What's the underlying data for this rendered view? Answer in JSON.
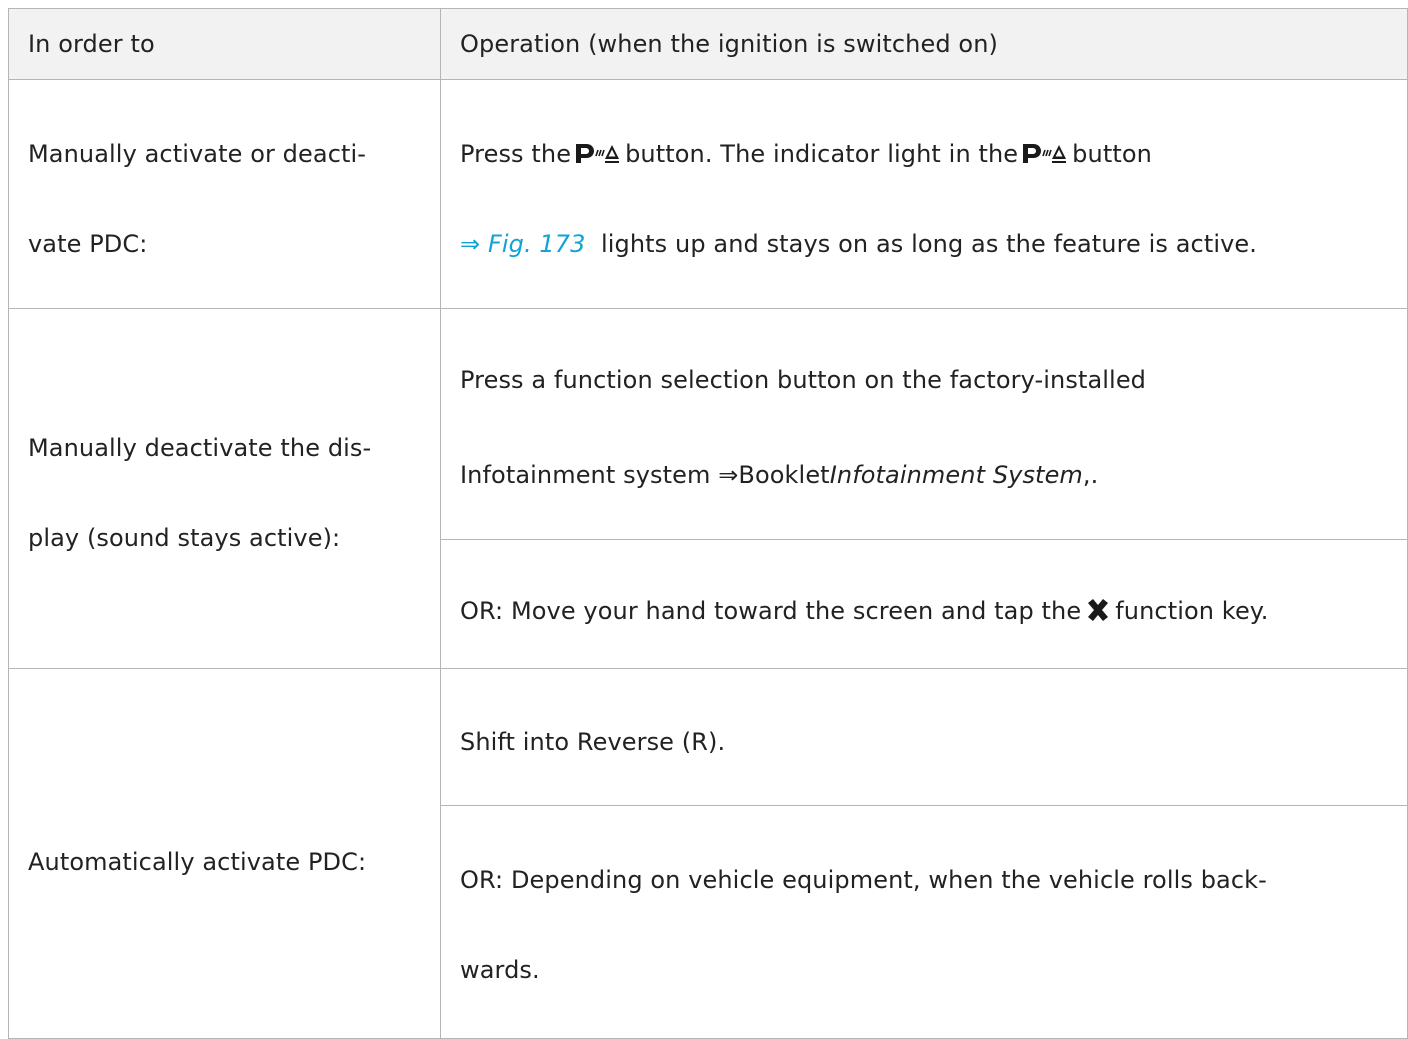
{
  "header": {
    "col1": "In order to",
    "col2": "Operation (when the ignition is switched on)"
  },
  "rows": {
    "r1": {
      "label_l1": "Manually activate or deacti-",
      "label_l2": "vate PDC:",
      "op_a": "Press the",
      "op_b": "button. The indicator light in the",
      "op_c": "button",
      "op_link": "⇒ Fig. 173",
      "op_d": "lights up and stays on as long as the feature is active."
    },
    "r2": {
      "label_l1": "Manually deactivate the dis-",
      "label_l2": "play (sound stays active):",
      "op1_l1": "Press a function selection button on the factory-installed",
      "op1_l2a": "Infotainment system ⇒Booklet",
      "op1_l2b": "Infotainment System",
      "op1_l2c": ",.",
      "op2_a": "OR: Move your hand toward the screen and tap the",
      "op2_b": "function key."
    },
    "r3": {
      "label": "Automatically activate PDC:",
      "op1": "Shift into Reverse (R).",
      "op2_l1": "OR: Depending on vehicle equipment, when the vehicle rolls back-",
      "op2_l2": "wards."
    }
  },
  "icons": {
    "parking": "park-distance-control-icon",
    "close": "close-x-icon"
  }
}
